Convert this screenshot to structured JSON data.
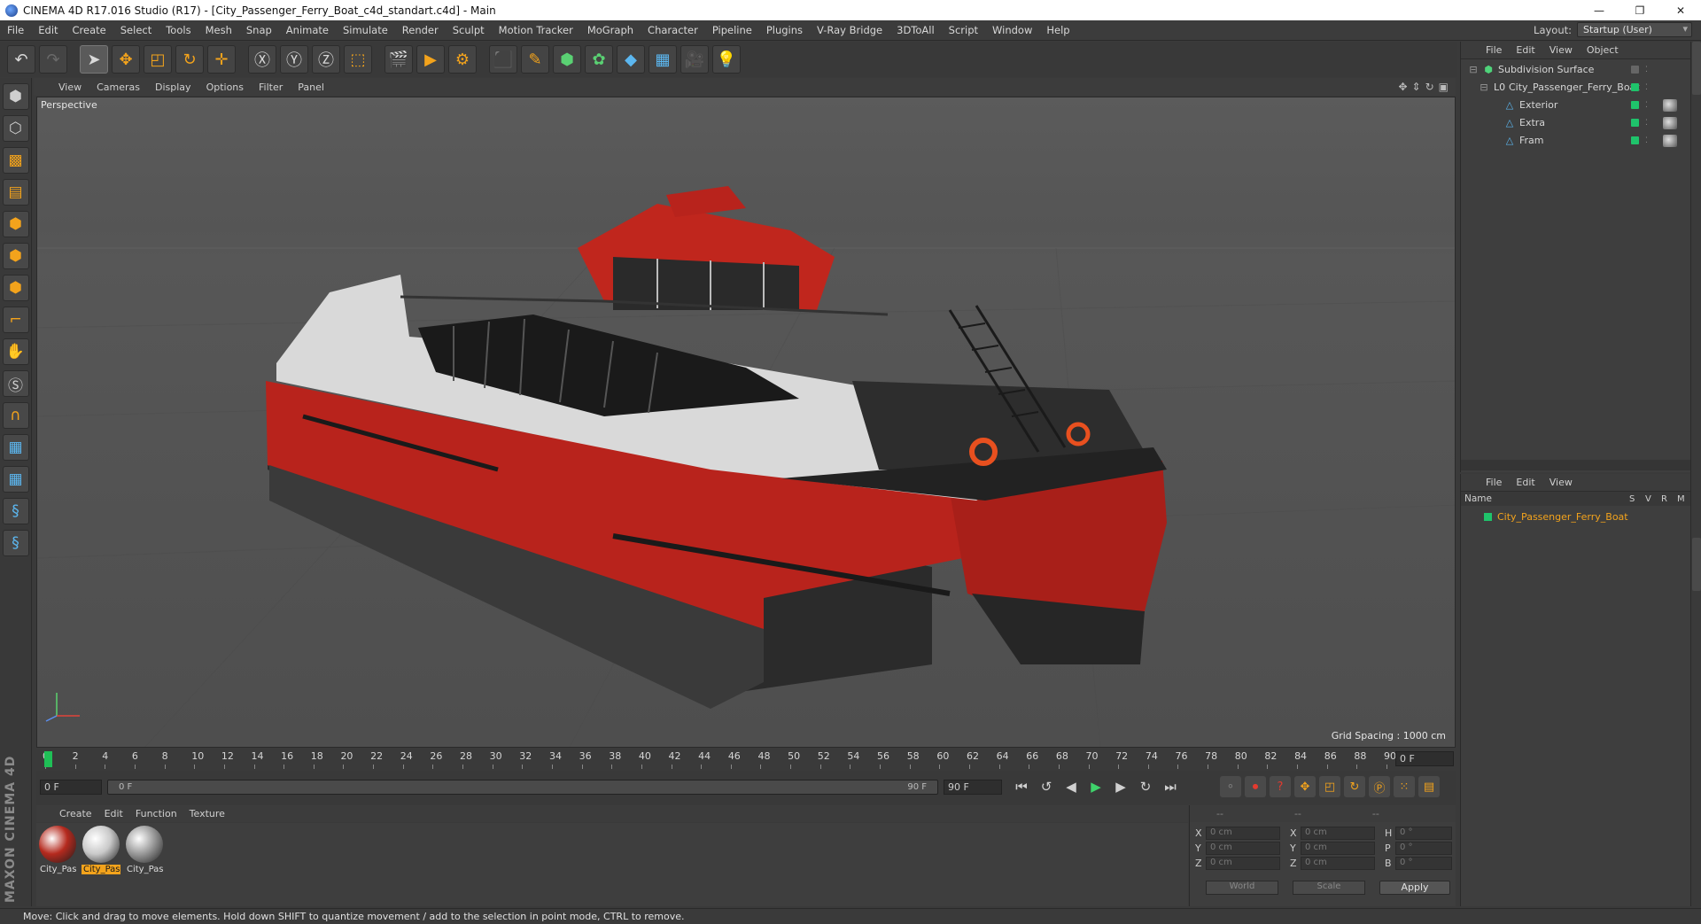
{
  "window": {
    "title": "CINEMA 4D R17.016 Studio (R17) - [City_Passenger_Ferry_Boat_c4d_standart.c4d] - Main",
    "controls": [
      "—",
      "❐",
      "✕"
    ]
  },
  "menubar": {
    "items": [
      "File",
      "Edit",
      "Create",
      "Select",
      "Tools",
      "Mesh",
      "Snap",
      "Animate",
      "Simulate",
      "Render",
      "Sculpt",
      "Motion Tracker",
      "MoGraph",
      "Character",
      "Pipeline",
      "Plugins",
      "V-Ray Bridge",
      "3DToAll",
      "Script",
      "Window",
      "Help"
    ],
    "layout_label": "Layout:",
    "layout_value": "Startup (User)"
  },
  "toolbar": {
    "buttons": [
      {
        "name": "undo-icon",
        "glyph": "↶",
        "style": ""
      },
      {
        "name": "redo-icon",
        "glyph": "↷",
        "style": "dim"
      },
      {
        "name": "select-cursor-icon",
        "glyph": "➤",
        "style": "active"
      },
      {
        "name": "move-icon",
        "glyph": "✥",
        "style": "orange"
      },
      {
        "name": "scale-icon",
        "glyph": "◰",
        "style": "orange"
      },
      {
        "name": "rotate-icon",
        "glyph": "↻",
        "style": "orange"
      },
      {
        "name": "transform-icon",
        "glyph": "✛",
        "style": "orange"
      },
      {
        "name": "x-axis-icon",
        "glyph": "Ⓧ",
        "style": ""
      },
      {
        "name": "y-axis-icon",
        "glyph": "Ⓨ",
        "style": ""
      },
      {
        "name": "z-axis-icon",
        "glyph": "Ⓩ",
        "style": ""
      },
      {
        "name": "coordinate-system-icon",
        "glyph": "⬚",
        "style": "orange"
      },
      {
        "name": "render-region-icon",
        "glyph": "🎬",
        "style": ""
      },
      {
        "name": "render-view-icon",
        "glyph": "▶",
        "style": "orange"
      },
      {
        "name": "render-settings-icon",
        "glyph": "⚙",
        "style": "orange"
      },
      {
        "name": "cube-icon",
        "glyph": "⬛",
        "style": "blue"
      },
      {
        "name": "pen-icon",
        "glyph": "✎",
        "style": "orange"
      },
      {
        "name": "subdivision-icon",
        "glyph": "⬢",
        "style": "green"
      },
      {
        "name": "mograph-cloner-icon",
        "glyph": "✿",
        "style": "green"
      },
      {
        "name": "deformer-icon",
        "glyph": "◆",
        "style": "blue"
      },
      {
        "name": "floor-icon",
        "glyph": "▦",
        "style": "blue"
      },
      {
        "name": "camera-icon",
        "glyph": "🎥",
        "style": ""
      },
      {
        "name": "light-icon",
        "glyph": "💡",
        "style": ""
      }
    ]
  },
  "leftbar": {
    "buttons": [
      {
        "name": "make-editable-icon",
        "glyph": "⬢",
        "style": "grey"
      },
      {
        "name": "model-mode-icon",
        "glyph": "⬡",
        "style": "grey"
      },
      {
        "name": "texture-mode-icon",
        "glyph": "▩",
        "style": ""
      },
      {
        "name": "workplane-mode-icon",
        "glyph": "▤",
        "style": ""
      },
      {
        "name": "points-mode-icon",
        "glyph": "⬢",
        "style": ""
      },
      {
        "name": "edges-mode-icon",
        "glyph": "⬢",
        "style": ""
      },
      {
        "name": "polygons-mode-icon",
        "glyph": "⬢",
        "style": ""
      },
      {
        "name": "axis-mode-icon",
        "glyph": "⌐",
        "style": ""
      },
      {
        "name": "tweak-mode-icon",
        "glyph": "✋",
        "style": ""
      },
      {
        "name": "snap-icon",
        "glyph": "Ⓢ",
        "style": "grey"
      },
      {
        "name": "magnet-icon",
        "glyph": "∩",
        "style": ""
      },
      {
        "name": "lock-workplane-icon",
        "glyph": "▦",
        "style": "blue"
      },
      {
        "name": "planar-workplane-icon",
        "glyph": "▦",
        "style": "blue"
      },
      {
        "name": "python-icon",
        "glyph": "§",
        "style": "blue"
      },
      {
        "name": "python-2-icon",
        "glyph": "§",
        "style": "blue"
      }
    ]
  },
  "viewport": {
    "menu": [
      "View",
      "Cameras",
      "Display",
      "Options",
      "Filter",
      "Panel"
    ],
    "label": "Perspective",
    "grid_spacing": "Grid Spacing : 1000 cm"
  },
  "timeline": {
    "ticks": [
      "0",
      "2",
      "4",
      "6",
      "8",
      "10",
      "12",
      "14",
      "16",
      "18",
      "20",
      "22",
      "24",
      "26",
      "28",
      "30",
      "32",
      "34",
      "36",
      "38",
      "40",
      "42",
      "44",
      "46",
      "48",
      "50",
      "52",
      "54",
      "56",
      "58",
      "60",
      "62",
      "64",
      "66",
      "68",
      "70",
      "72",
      "74",
      "76",
      "78",
      "80",
      "82",
      "84",
      "86",
      "88",
      "90"
    ],
    "current_frame": "0 F"
  },
  "transport": {
    "start_field": "0 F",
    "slider_left": "0 F",
    "slider_right": "90 F",
    "end_field": "90 F",
    "buttons": [
      {
        "name": "goto-start-icon",
        "glyph": "⏮"
      },
      {
        "name": "prev-key-icon",
        "glyph": "↺"
      },
      {
        "name": "prev-frame-icon",
        "glyph": "◀"
      },
      {
        "name": "play-icon",
        "glyph": "▶"
      },
      {
        "name": "next-frame-icon",
        "glyph": "▶"
      },
      {
        "name": "loop-icon",
        "glyph": "↻"
      },
      {
        "name": "goto-end-icon",
        "glyph": "⏭"
      }
    ],
    "record_buttons": [
      {
        "name": "keyframe-selection-icon",
        "glyph": "⚬",
        "style": "dim"
      },
      {
        "name": "record-icon",
        "glyph": "⏺",
        "style": "red"
      },
      {
        "name": "autokey-icon",
        "glyph": "?",
        "style": "red"
      },
      {
        "name": "key-position-icon",
        "glyph": "✥",
        "style": ""
      },
      {
        "name": "key-scale-icon",
        "glyph": "◰",
        "style": ""
      },
      {
        "name": "key-rotation-icon",
        "glyph": "↻",
        "style": ""
      },
      {
        "name": "key-param-icon",
        "glyph": "Ⓟ",
        "style": ""
      },
      {
        "name": "key-pla-icon",
        "glyph": "⁙",
        "style": ""
      },
      {
        "name": "timeline-window-icon",
        "glyph": "▤",
        "style": ""
      }
    ]
  },
  "materials": {
    "menu": [
      "Create",
      "Edit",
      "Function",
      "Texture"
    ],
    "items": [
      {
        "label": "City_Pas",
        "selected": false,
        "color": "#b52a1e"
      },
      {
        "label": "City_Pas",
        "selected": true,
        "color": "#c9c9c9"
      },
      {
        "label": "City_Pas",
        "selected": false,
        "color": "#9a9a9a"
      }
    ]
  },
  "coordinates": {
    "header": [
      "--",
      "--",
      "--"
    ],
    "rows": [
      {
        "a1": "X",
        "v1": "0 cm",
        "a2": "X",
        "v2": "0 cm",
        "a3": "H",
        "v3": "0 °"
      },
      {
        "a1": "Y",
        "v1": "0 cm",
        "a2": "Y",
        "v2": "0 cm",
        "a3": "P",
        "v3": "0 °"
      },
      {
        "a1": "Z",
        "v1": "0 cm",
        "a2": "Z",
        "v2": "0 cm",
        "a3": "B",
        "v3": "0 °"
      }
    ],
    "world": "World",
    "scale": "Scale",
    "apply": "Apply"
  },
  "status": {
    "text": "Move: Click and drag to move elements. Hold down SHIFT to quantize movement / add to the selection in point mode, CTRL to remove."
  },
  "brand": {
    "text": "MAXON CINEMA 4D"
  },
  "object_manager": {
    "menu": [
      "File",
      "Edit",
      "View",
      "Object"
    ],
    "items": [
      {
        "label": "Subdivision Surface",
        "indent": 0,
        "icon": "⬢"
      },
      {
        "label": "City_Passenger_Ferry_Boat",
        "indent": 1,
        "icon": "L0"
      },
      {
        "label": "Exterior",
        "indent": 2,
        "icon": "△"
      },
      {
        "label": "Extra",
        "indent": 2,
        "icon": "△"
      },
      {
        "label": "Fram",
        "indent": 2,
        "icon": "△"
      }
    ]
  },
  "layer_manager": {
    "menu": [
      "File",
      "Edit",
      "View"
    ],
    "columns": {
      "name": "Name",
      "s": "S",
      "v": "V",
      "r": "R",
      "m": "M"
    },
    "row": "City_Passenger_Ferry_Boat"
  }
}
